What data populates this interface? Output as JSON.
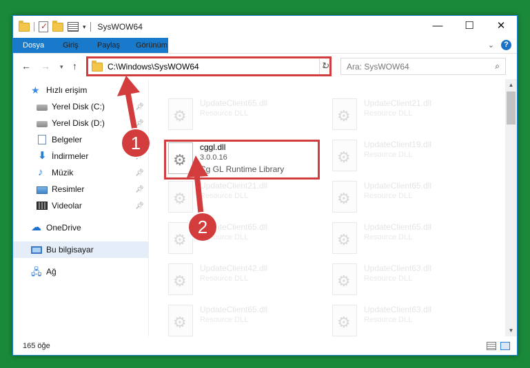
{
  "window": {
    "title": "SysWOW64",
    "controls": {
      "minimize": "—",
      "maximize": "☐",
      "close": "✕"
    }
  },
  "ribbon": {
    "tabs": [
      "Dosya",
      "Giriş",
      "Paylaş",
      "Görünüm"
    ],
    "help": "?",
    "collapse": "⌄"
  },
  "address": {
    "path": "C:\\Windows\\SysWOW64",
    "search_placeholder": "Ara: SysWOW64"
  },
  "nav_pane": {
    "items": [
      {
        "label": "Hızlı erişim",
        "icon": "star-icon",
        "pinned": false
      },
      {
        "label": "Yerel Disk (C:)",
        "icon": "drive-icon",
        "pinned": true
      },
      {
        "label": "Yerel Disk (D:)",
        "icon": "drive-icon",
        "pinned": true
      },
      {
        "label": "Belgeler",
        "icon": "documents-icon",
        "pinned": true
      },
      {
        "label": "İndirmeler",
        "icon": "downloads-icon",
        "pinned": true
      },
      {
        "label": "Müzik",
        "icon": "music-icon",
        "pinned": true
      },
      {
        "label": "Resimler",
        "icon": "pictures-icon",
        "pinned": true
      },
      {
        "label": "Videolar",
        "icon": "videos-icon",
        "pinned": true
      },
      {
        "label": "OneDrive",
        "icon": "onedrive-icon",
        "pinned": false
      },
      {
        "label": "Bu bilgisayar",
        "icon": "computer-icon",
        "pinned": false,
        "selected": true
      },
      {
        "label": "Ağ",
        "icon": "network-icon",
        "pinned": false
      }
    ]
  },
  "files": {
    "left_column": [
      {
        "name": "UpdateClient65.dll",
        "type": "Resource DLL"
      },
      {
        "name": "cggl.dll",
        "version": "3.0.0.16",
        "type": "Cg GL Runtime Library",
        "active": true
      },
      {
        "name": "UpdateClient21.dll",
        "type": "Resource DLL"
      },
      {
        "name": "UpdateClient65.dll",
        "type": "Resource DLL"
      },
      {
        "name": "UpdateClient42.dll",
        "type": "Resource DLL"
      },
      {
        "name": "UpdateClient65.dll",
        "type": "Resource DLL"
      }
    ],
    "right_column": [
      {
        "name": "UpdateClient21.dll",
        "type": "Resource DLL"
      },
      {
        "name": "UpdateClient19.dll",
        "type": "Resource DLL"
      },
      {
        "name": "UpdateClient65.dll",
        "type": "Resource DLL"
      },
      {
        "name": "UpdateClient65.dll",
        "type": "Resource DLL"
      },
      {
        "name": "UpdateClient63.dll",
        "type": "Resource DLL"
      },
      {
        "name": "UpdateClient63.dll",
        "type": "Resource DLL"
      }
    ]
  },
  "status": {
    "count": "165 öğe"
  },
  "annotations": {
    "step1": "1",
    "step2": "2",
    "color": "#d23c3c"
  }
}
